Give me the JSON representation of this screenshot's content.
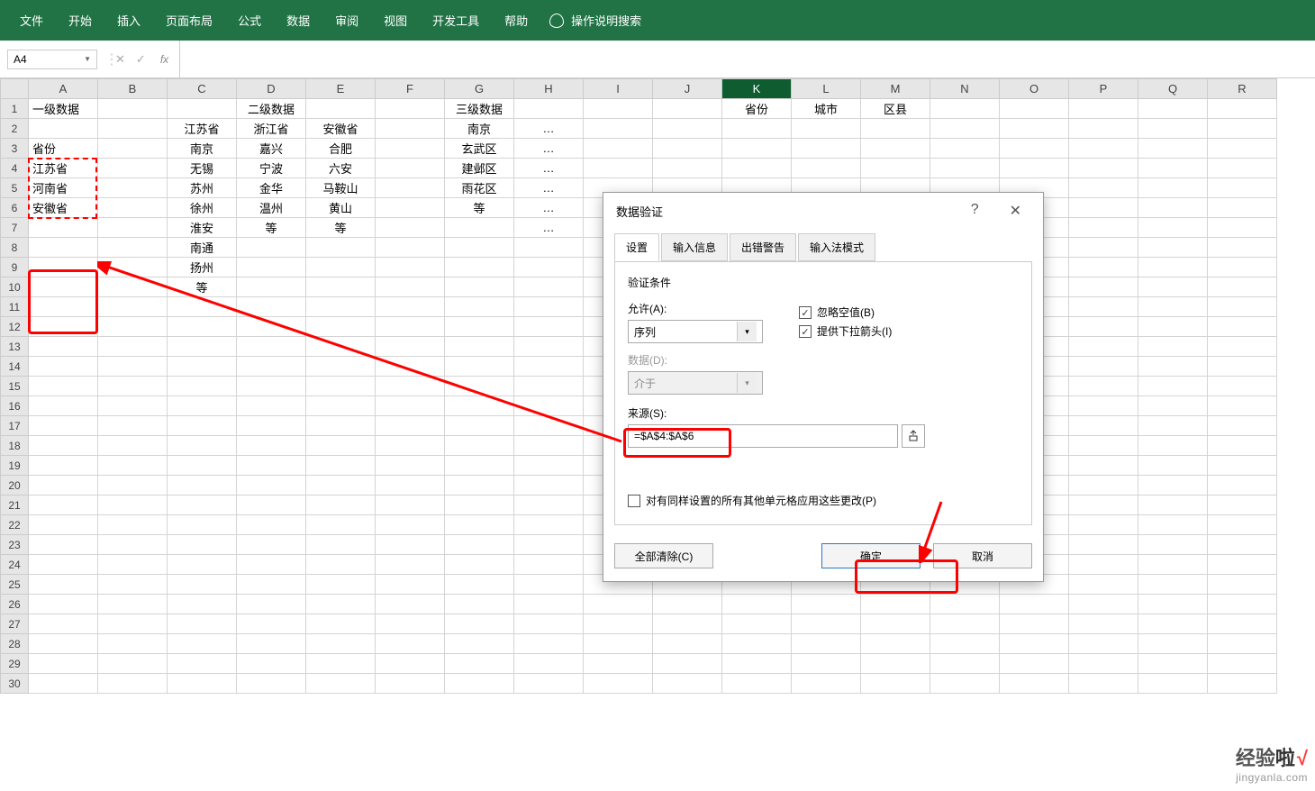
{
  "ribbon": {
    "tabs": [
      "文件",
      "开始",
      "插入",
      "页面布局",
      "公式",
      "数据",
      "审阅",
      "视图",
      "开发工具",
      "帮助"
    ],
    "search_prompt": "操作说明搜索"
  },
  "name_box": {
    "value": "A4"
  },
  "fx_label": "fx",
  "columns": [
    "A",
    "B",
    "C",
    "D",
    "E",
    "F",
    "G",
    "H",
    "I",
    "J",
    "K",
    "L",
    "M",
    "N",
    "O",
    "P",
    "Q",
    "R"
  ],
  "row_count": 30,
  "selected_col": "K",
  "grid": {
    "A1": "一级数据",
    "D1": "二级数据",
    "G1": "三级数据",
    "K1": "省份",
    "L1": "城市",
    "M1": "区县",
    "C2": "江苏省",
    "D2": "浙江省",
    "E2": "安徽省",
    "G2": "南京",
    "H2": "…",
    "A3": "省份",
    "C3": "南京",
    "D3": "嘉兴",
    "E3": "合肥",
    "G3": "玄武区",
    "H3": "…",
    "A4": "江苏省",
    "C4": "无锡",
    "D4": "宁波",
    "E4": "六安",
    "G4": "建邺区",
    "H4": "…",
    "A5": "河南省",
    "C5": "苏州",
    "D5": "金华",
    "E5": "马鞍山",
    "G5": "雨花区",
    "H5": "…",
    "A6": "安徽省",
    "C6": "徐州",
    "D6": "温州",
    "E6": "黄山",
    "G6": "等",
    "H6": "…",
    "C7": "淮安",
    "D7": "等",
    "E7": "等",
    "H7": "…",
    "C8": "南通",
    "C9": "扬州",
    "C10": "等"
  },
  "dialog": {
    "title": "数据验证",
    "help": "?",
    "tabs": [
      "设置",
      "输入信息",
      "出错警告",
      "输入法模式"
    ],
    "active_tab": 0,
    "condition_label": "验证条件",
    "allow_label": "允许(A):",
    "allow_value": "序列",
    "ignore_blank": "忽略空值(B)",
    "provide_dropdown": "提供下拉箭头(I)",
    "data_label": "数据(D):",
    "data_value": "介于",
    "source_label": "来源(S):",
    "source_value": "=$A$4:$A$6",
    "apply_same": "对有同样设置的所有其他单元格应用这些更改(P)",
    "clear_all": "全部清除(C)",
    "ok": "确定",
    "cancel": "取消"
  },
  "watermark": {
    "top_a": "经验",
    "top_b": "啦",
    "check": "√",
    "url": "jingyanla.com"
  }
}
